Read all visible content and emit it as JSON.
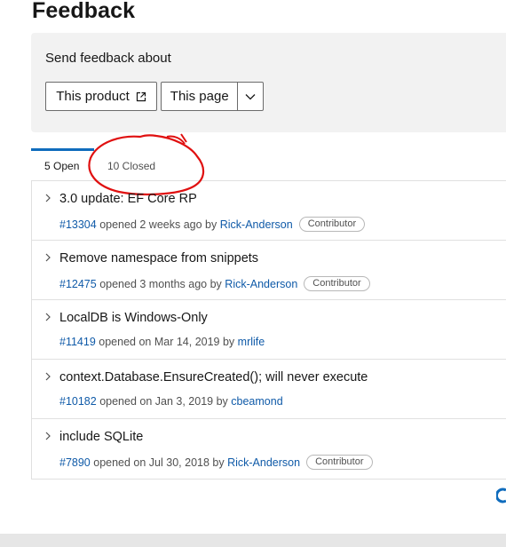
{
  "page": {
    "title": "Feedback"
  },
  "send": {
    "label": "Send feedback about",
    "product_button": "This product",
    "page_button": "This page"
  },
  "tabs": [
    {
      "label": "5 Open",
      "active": true
    },
    {
      "label": "10 Closed",
      "active": false
    }
  ],
  "issues": [
    {
      "title": "3.0 update: EF Core RP",
      "number": "#13304",
      "opened": "opened 2 weeks ago by",
      "author": "Rick-Anderson",
      "badge": "Contributor"
    },
    {
      "title": "Remove namespace from snippets",
      "number": "#12475",
      "opened": "opened 3 months ago by",
      "author": "Rick-Anderson",
      "badge": "Contributor"
    },
    {
      "title": "LocalDB is Windows-Only",
      "number": "#11419",
      "opened": "opened on Mar 14, 2019 by",
      "author": "mrlife",
      "badge": ""
    },
    {
      "title": "context.Database.EnsureCreated(); will never execute",
      "number": "#10182",
      "opened": "opened on Jan 3, 2019 by",
      "author": "cbeamond",
      "badge": ""
    },
    {
      "title": "include SQLite",
      "number": "#7890",
      "opened": "opened on Jul 30, 2018 by",
      "author": "Rick-Anderson",
      "badge": "Contributor"
    }
  ],
  "icons": {
    "external": "external-link-icon",
    "dropdown": "chevron-down-icon",
    "expand": "chevron-right-icon",
    "annotation": "red-circle-annotation",
    "corner": "loading-spinner-icon"
  },
  "colors": {
    "link": "#0f5aa8",
    "tab_accent": "#0f6cbd",
    "annotation": "#e01010",
    "panel_bg": "#f2f2f2"
  }
}
